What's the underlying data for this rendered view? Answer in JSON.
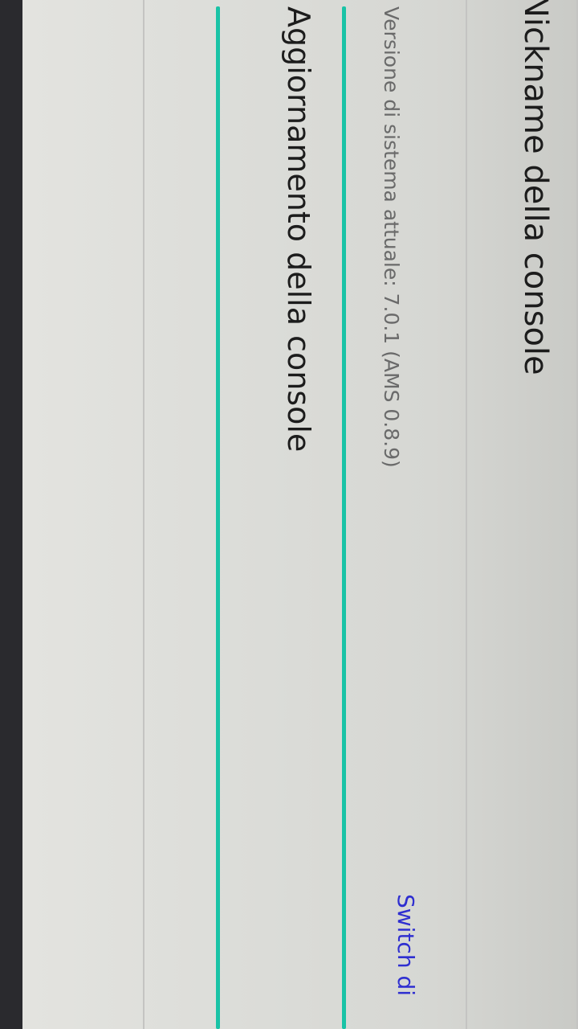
{
  "settings": {
    "nickname_label": "Nickname della console",
    "version_text": "Versione di sistema attuale: 7.0.1 (AMS 0.8.9)",
    "update_label": "Aggiornamento della console"
  },
  "footer": {
    "link_label": "Switch di"
  },
  "colors": {
    "accent": "#19c3a6",
    "link": "#2f2fd0",
    "background": "#dcddd9"
  }
}
